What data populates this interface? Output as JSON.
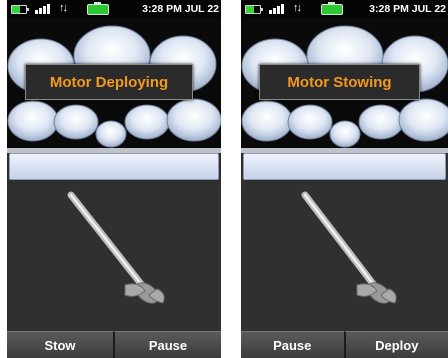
{
  "screens": [
    {
      "status": {
        "time": "3:28 PM  JUL 22"
      },
      "title": "Motor Deploying",
      "buttons": {
        "left": "Stow",
        "right": "Pause"
      }
    },
    {
      "status": {
        "time": "3:28 PM  JUL 22"
      },
      "title": "Motor Stowing",
      "buttons": {
        "left": "Pause",
        "right": "Deploy"
      }
    }
  ],
  "colors": {
    "accent": "#f29a1e",
    "battery": "#2cc834"
  },
  "icons": [
    "battery-icon",
    "signal-icon",
    "sync-arrows-icon",
    "motor-icon"
  ]
}
